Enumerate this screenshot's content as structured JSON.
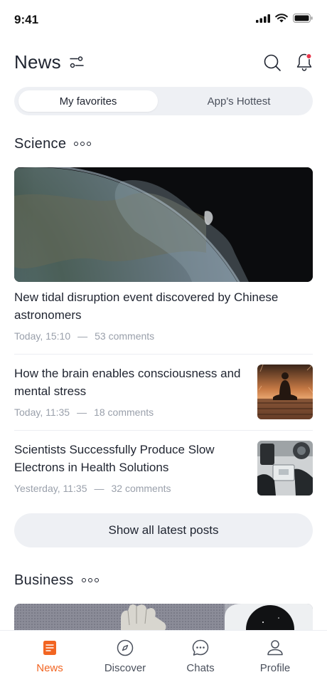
{
  "status_bar": {
    "time": "9:41"
  },
  "header": {
    "title": "News"
  },
  "tabs": {
    "active": "My favorites",
    "inactive": "App's Hottest"
  },
  "science": {
    "title": "Science",
    "featured": {
      "title": "New tidal disruption event discovered by Chinese astronomers",
      "time": "Today, 15:10",
      "comments": "53 comments"
    },
    "items": [
      {
        "title": "How the brain enables consciousness and mental stress",
        "time": "Today, 11:35",
        "comments": "18 comments"
      },
      {
        "title": "Scientists Successfully Produce Slow Electrons in Health Solutions",
        "time": "Yesterday, 11:35",
        "comments": "32 comments"
      }
    ],
    "show_all": "Show all latest posts"
  },
  "business": {
    "title": "Business"
  },
  "bottom_nav": [
    {
      "label": "News",
      "icon": "news-icon",
      "active": true
    },
    {
      "label": "Discover",
      "icon": "compass-icon",
      "active": false
    },
    {
      "label": "Chats",
      "icon": "chat-bubble-icon",
      "active": false
    },
    {
      "label": "Profile",
      "icon": "profile-icon",
      "active": false
    }
  ],
  "colors": {
    "accent": "#f26522",
    "text": "#1f2430",
    "muted": "#9aa0ab",
    "surface": "#eef0f4",
    "notification_dot": "#e8344a"
  }
}
